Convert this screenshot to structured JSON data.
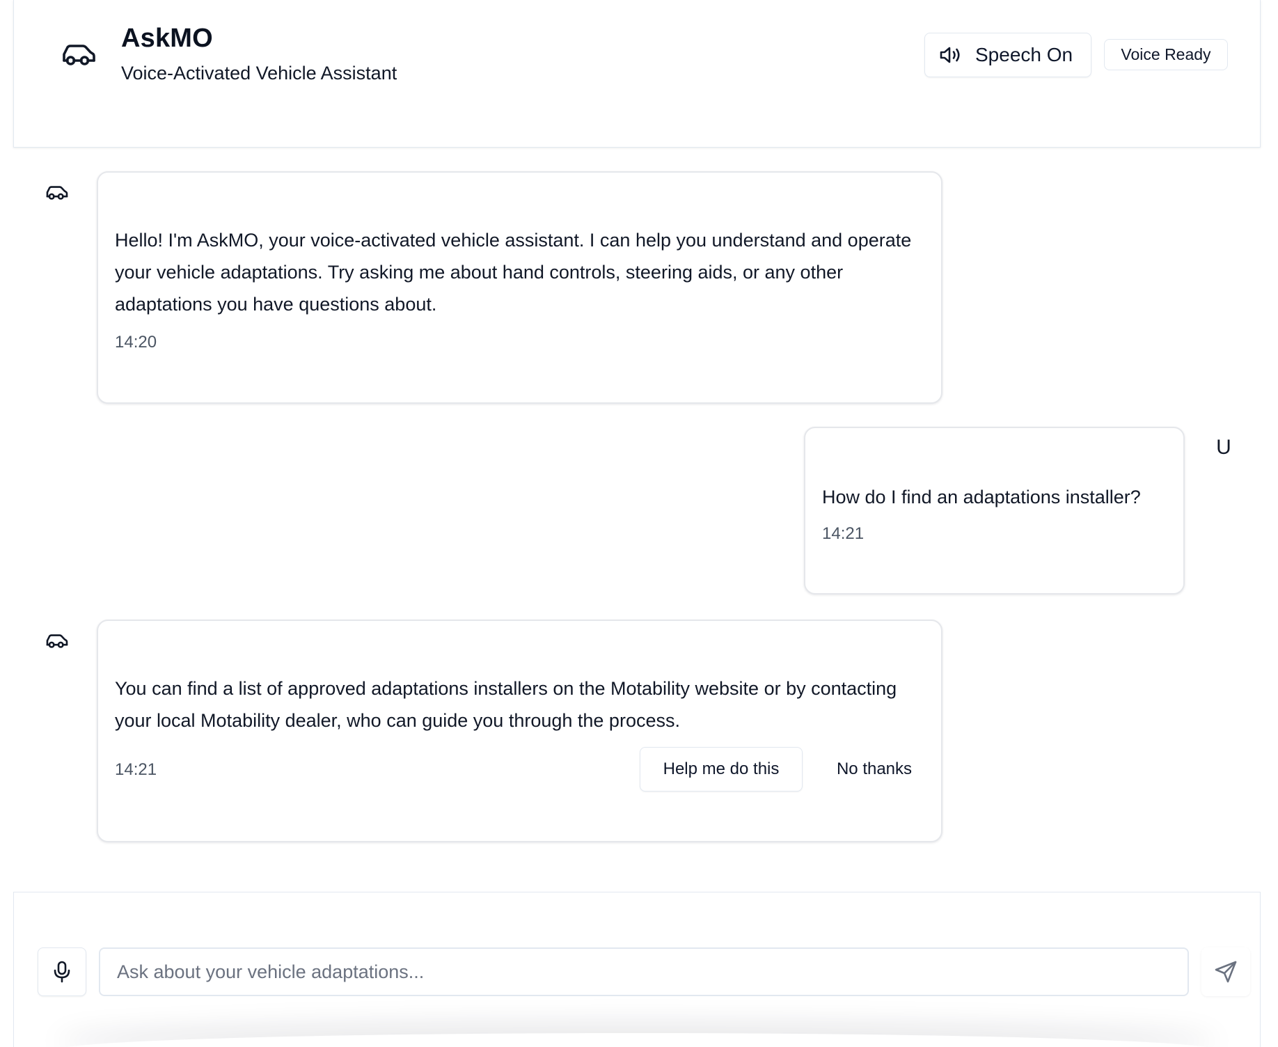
{
  "header": {
    "logo_icon": "car-icon",
    "title": "AskMO",
    "subtitle": "Voice-Activated Vehicle Assistant",
    "speech_toggle": {
      "icon": "speaker-icon",
      "label": "Speech On"
    },
    "status_badge": "Voice Ready"
  },
  "messages": [
    {
      "role": "assistant",
      "avatar_icon": "car-icon",
      "text": "Hello! I'm AskMO, your voice-activated vehicle assistant. I can help you understand and operate your vehicle adaptations. Try asking me about hand controls, steering aids, or any other adaptations you have questions about.",
      "time": "14:20"
    },
    {
      "role": "user",
      "avatar": "U",
      "text": "How do I find an adaptations installer?",
      "time": "14:21"
    },
    {
      "role": "assistant",
      "avatar_icon": "car-icon",
      "text": "You can find a list of approved adaptations installers on the Motability website or by contacting your local Motability dealer, who can guide you through the process.",
      "time": "14:21",
      "actions": [
        "Help me do this",
        "No thanks"
      ]
    }
  ],
  "composer": {
    "mic_icon": "microphone-icon",
    "placeholder": "Ask about your vehicle adaptations...",
    "value": "",
    "send_icon": "send-icon"
  }
}
